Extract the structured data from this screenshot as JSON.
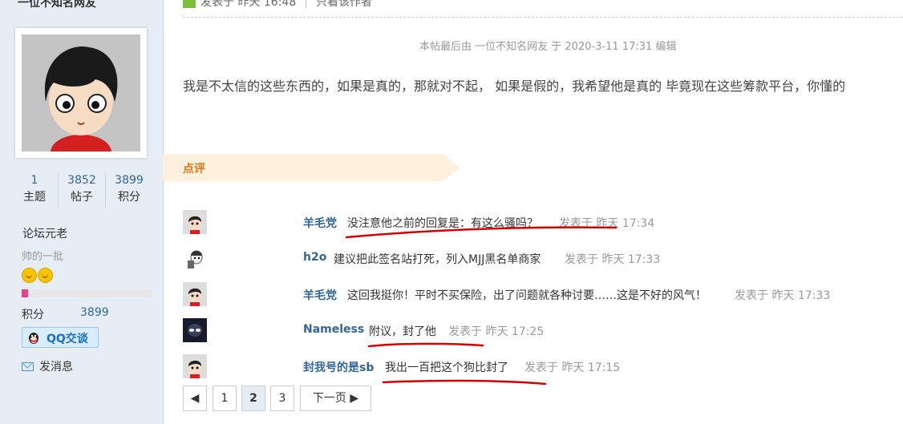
{
  "profile": {
    "username": "一位不知名网友",
    "stats": [
      {
        "value": "1",
        "label": "主题"
      },
      {
        "value": "3852",
        "label": "帖子"
      },
      {
        "value": "3899",
        "label": "积分"
      }
    ],
    "rank": "论坛元老",
    "custom_title": "帅的一批",
    "level_progress": 0.05,
    "credit_label": "积分",
    "credit_value": "3899",
    "qq_button": "QQ交谈",
    "send_message": "发消息"
  },
  "post": {
    "meta_posted": "发表于 昨天 16:48",
    "meta_only_author": "只看该作者",
    "edit_note": "本帖最后由 一位不知名网友 于 2020-3-11 17:31 编辑",
    "body": "我是不太信的这些东西的，如果是真的，那就对不起， 如果是假的，我希望他是真的 毕竟现在这些筹款平台，你懂的"
  },
  "dianping": {
    "title": "点评",
    "comments": [
      {
        "name": "羊毛党",
        "text": "没注意他之前的回复是：有这么骚吗？",
        "time": "发表于 昨天 17:34"
      },
      {
        "name": "h2o",
        "text": "建议把此签名站打死，列入MJJ黑名单商家",
        "time": "发表于 昨天 17:33"
      },
      {
        "name": "羊毛党",
        "text": "这回我挺你！平时不买保险，出了问题就各种讨要……这是不好的风气！",
        "time": "发表于 昨天 17:33"
      },
      {
        "name": "Nameless",
        "text": "附议，封了他",
        "time": "发表于 昨天 17:25"
      },
      {
        "name": "封我号的是sb",
        "text": "我出一百把这个狗比封了",
        "time": "发表于 昨天 17:15"
      }
    ]
  },
  "pager": {
    "prev": "◀",
    "pages": [
      "1",
      "2",
      "3"
    ],
    "current": "2",
    "next": "下一页 ▶"
  },
  "colors": {
    "link": "#336699",
    "accent_orange": "#e37417",
    "annotation_red": "#d40000",
    "sidebar_bg": "#e6edf5"
  }
}
